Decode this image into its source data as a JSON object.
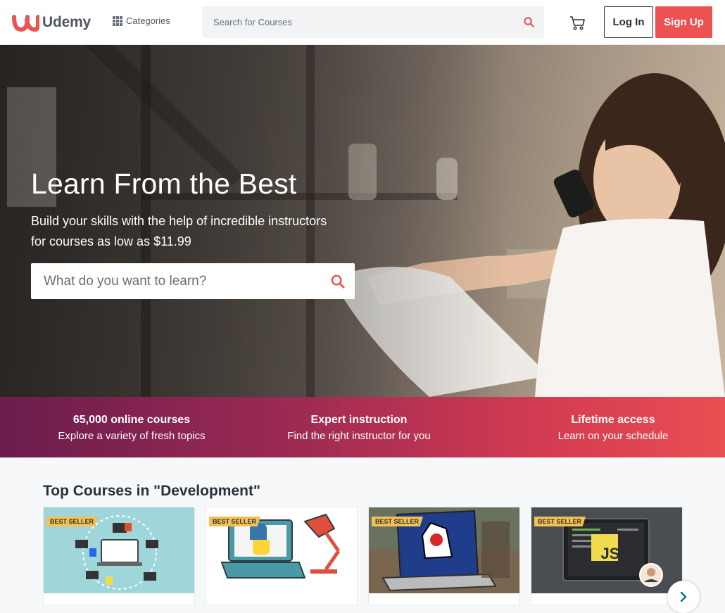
{
  "header": {
    "logo_text": "Udemy",
    "categories_label": "Categories",
    "search_placeholder": "Search for Courses",
    "login_label": "Log In",
    "signup_label": "Sign Up"
  },
  "hero": {
    "title": "Learn From the Best",
    "subtitle_line1": "Build your skills with the help of incredible instructors",
    "subtitle_line2": "for courses as low as $11.99",
    "search_placeholder": "What do you want to learn?"
  },
  "value_props": [
    {
      "title": "65,000 online courses",
      "desc": "Explore a variety of fresh topics"
    },
    {
      "title": "Expert instruction",
      "desc": "Find the right instructor for you"
    },
    {
      "title": "Lifetime access",
      "desc": "Learn on your schedule"
    }
  ],
  "courses_section": {
    "title": "Top Courses in \"Development\"",
    "courses": [
      {
        "badge": "BEST SELLER",
        "code_label": ""
      },
      {
        "badge": "BEST SELLER",
        "code_label": ""
      },
      {
        "badge": "BEST SELLER",
        "code_label": ""
      },
      {
        "badge": "BEST SELLER",
        "code_label": "JS"
      }
    ]
  },
  "colors": {
    "brand_red": "#ec5252",
    "text_dark": "#29303b",
    "badge_yellow": "#f4c150"
  }
}
